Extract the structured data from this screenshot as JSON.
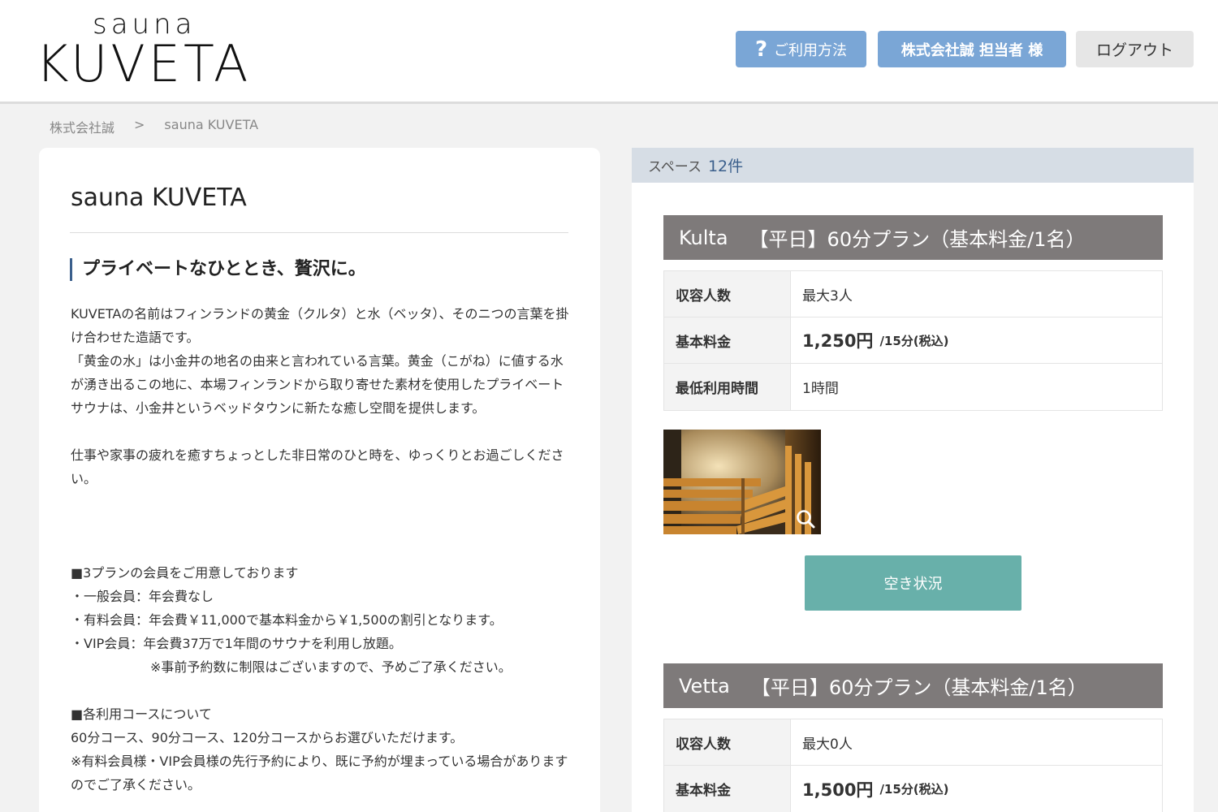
{
  "header": {
    "logo_top": "sauna",
    "logo_main": "KUVETA",
    "help_icon": "?",
    "help_label": "ご利用方法",
    "user_label": "株式会社誠 担当者 様",
    "logout_label": "ログアウト"
  },
  "breadcrumb": {
    "items": [
      "株式会社誠",
      ">",
      "sauna KUVETA"
    ]
  },
  "facility": {
    "title": "sauna KUVETA",
    "catch": "プライベートなひととき、贅沢に。",
    "paragraphs": [
      "KUVETAの名前はフィンランドの黄金（クルタ）と水（ベッタ）、そのニつの言葉を掛け合わせた造語です。",
      "「黄金の水」は小金井の地名の由来と言われている言葉。黄金（こがね）に値する水が湧き出るこの地に、本場フィンランドから取り寄せた素材を使用したプライベートサウナは、小金井というベッドタウンに新たな癒し空間を提供します。",
      "仕事や家事の疲れを癒すちょっとした非日常のひと時を、ゆっくりとお過ごしください。"
    ],
    "membership": {
      "heading": "■3プランの会員をご用意しております",
      "lines": [
        "・一般会員：年会費なし",
        "・有料会員：年会費￥11,000で基本料金から￥1,500の割引となります。",
        "・VIP会員：年会費37万で1年間のサウナを利用し放題。"
      ],
      "note": "※事前予約数に制限はございますので、予めご了承ください。"
    },
    "courses": {
      "heading": "■各利用コースについて",
      "lines": [
        "60分コース、90分コース、120分コースからお選びいただけます。",
        "※有料会員様・VIP会員様の先行予約により、既に予約が埋まっている場合がありますのでご了承ください。"
      ]
    }
  },
  "spaces": {
    "label": "スペース",
    "count": "12件",
    "plans": [
      {
        "name": "Kulta",
        "plan": "【平日】60分プラン（基本料金/1名）",
        "rows": [
          {
            "key": "収容人数",
            "value": "最大3人"
          },
          {
            "key": "基本料金",
            "price": "1,250円",
            "unit": "/15分(税込)"
          },
          {
            "key": "最低利用時間",
            "value": "1時間"
          }
        ],
        "zoom_icon": "magnifier-icon",
        "availability_label": "空き状況"
      },
      {
        "name": "Vetta",
        "plan": "【平日】60分プラン（基本料金/1名）",
        "rows": [
          {
            "key": "収容人数",
            "value": "最大0人"
          },
          {
            "key": "基本料金",
            "price": "1,500円",
            "unit": "/15分(税込)"
          }
        ]
      }
    ]
  },
  "colors": {
    "button_blue": "#7aa6d6",
    "plan_header": "#7e7a7a",
    "availability": "#68b0aa",
    "space_bar": "#d6dde5"
  }
}
